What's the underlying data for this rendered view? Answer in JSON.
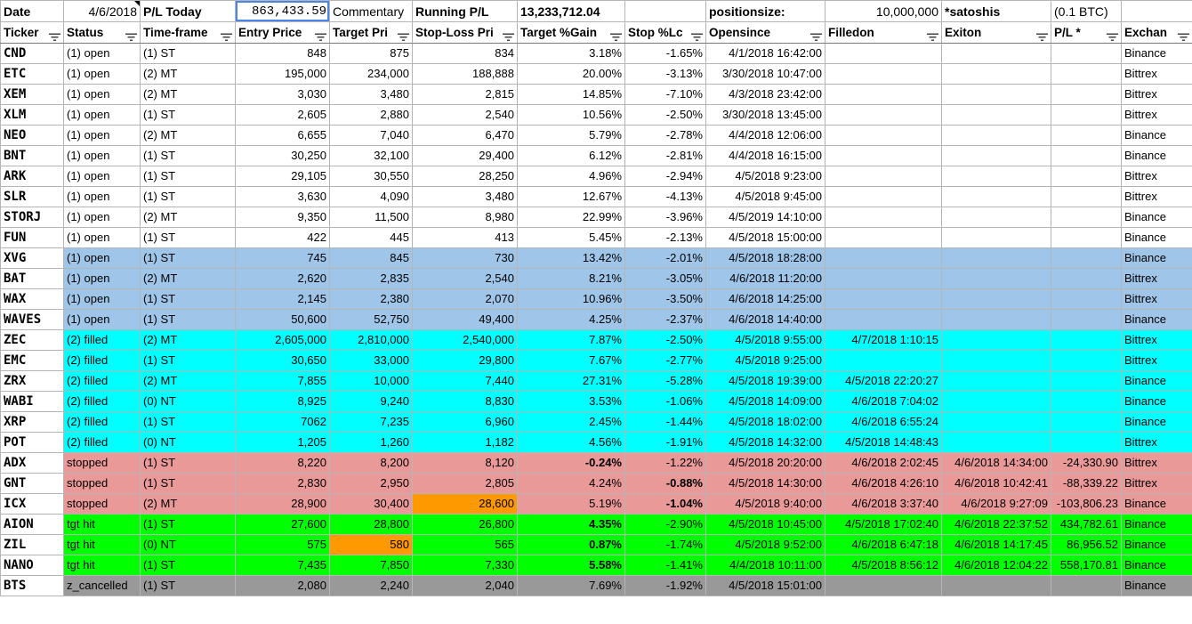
{
  "top": {
    "date_label": "Date",
    "date_value": "4/6/2018",
    "pl_today_label": "P/L Today",
    "pl_today_value": "863,433.59",
    "commentary_label": "Commentary",
    "running_label": "Running P/L",
    "running_value": "13,233,712.04",
    "positionsize_label": "positionsize:",
    "positionsize_value": "10,000,000",
    "unit_label": "*satoshis",
    "btc_note": "(0.1 BTC)"
  },
  "headers": [
    "Ticker",
    "Status",
    "Time-frame",
    "Entry Price",
    "Target Pri",
    "Stop-Loss Pri",
    "Target %Gain",
    "Stop %Lc",
    "Opensince",
    "Filledon",
    "Exiton",
    "P/L *",
    "Exchan"
  ],
  "colors": {
    "open_highlight": "#9fc5e8",
    "filled": "#00ffff",
    "stopped": "#ea9999",
    "tgt_hit": "#00ff00",
    "cancelled": "#999999",
    "orange_cell": "#ff9900"
  },
  "rows": [
    {
      "ticker": "CND",
      "status": "(1) open",
      "tf": "(1) ST",
      "entry": "848",
      "target": "875",
      "stop": "834",
      "tgain": "3.18%",
      "sloss": "-1.65%",
      "open": "4/1/2018 16:42:00",
      "filled": "",
      "exit": "",
      "pl": "",
      "exch": "Binance"
    },
    {
      "ticker": "ETC",
      "status": "(1) open",
      "tf": "(2) MT",
      "entry": "195,000",
      "target": "234,000",
      "stop": "188,888",
      "tgain": "20.00%",
      "sloss": "-3.13%",
      "open": "3/30/2018 10:47:00",
      "filled": "",
      "exit": "",
      "pl": "",
      "exch": "Bittrex"
    },
    {
      "ticker": "XEM",
      "status": "(1) open",
      "tf": "(2) MT",
      "entry": "3,030",
      "target": "3,480",
      "stop": "2,815",
      "tgain": "14.85%",
      "sloss": "-7.10%",
      "open": "4/3/2018 23:42:00",
      "filled": "",
      "exit": "",
      "pl": "",
      "exch": "Bittrex"
    },
    {
      "ticker": "XLM",
      "status": "(1) open",
      "tf": "(1) ST",
      "entry": "2,605",
      "target": "2,880",
      "stop": "2,540",
      "tgain": "10.56%",
      "sloss": "-2.50%",
      "open": "3/30/2018 13:45:00",
      "filled": "",
      "exit": "",
      "pl": "",
      "exch": "Bittrex"
    },
    {
      "ticker": "NEO",
      "status": "(1) open",
      "tf": "(2) MT",
      "entry": "6,655",
      "target": "7,040",
      "stop": "6,470",
      "tgain": "5.79%",
      "sloss": "-2.78%",
      "open": "4/4/2018 12:06:00",
      "filled": "",
      "exit": "",
      "pl": "",
      "exch": "Binance"
    },
    {
      "ticker": "BNT",
      "status": "(1) open",
      "tf": "(1) ST",
      "entry": "30,250",
      "target": "32,100",
      "stop": "29,400",
      "tgain": "6.12%",
      "sloss": "-2.81%",
      "open": "4/4/2018 16:15:00",
      "filled": "",
      "exit": "",
      "pl": "",
      "exch": "Binance"
    },
    {
      "ticker": "ARK",
      "status": "(1) open",
      "tf": "(1) ST",
      "entry": "29,105",
      "target": "30,550",
      "stop": "28,250",
      "tgain": "4.96%",
      "sloss": "-2.94%",
      "open": "4/5/2018 9:23:00",
      "filled": "",
      "exit": "",
      "pl": "",
      "exch": "Bittrex"
    },
    {
      "ticker": "SLR",
      "status": "(1) open",
      "tf": "(1) ST",
      "entry": "3,630",
      "target": "4,090",
      "stop": "3,480",
      "tgain": "12.67%",
      "sloss": "-4.13%",
      "open": "4/5/2018 9:45:00",
      "filled": "",
      "exit": "",
      "pl": "",
      "exch": "Bittrex"
    },
    {
      "ticker": "STORJ",
      "status": "(1) open",
      "tf": "(2) MT",
      "entry": "9,350",
      "target": "11,500",
      "stop": "8,980",
      "tgain": "22.99%",
      "sloss": "-3.96%",
      "open": "4/5/2019 14:10:00",
      "filled": "",
      "exit": "",
      "pl": "",
      "exch": "Binance"
    },
    {
      "ticker": "FUN",
      "status": "(1) open",
      "tf": "(1) ST",
      "entry": "422",
      "target": "445",
      "stop": "413",
      "tgain": "5.45%",
      "sloss": "-2.13%",
      "open": "4/5/2018 15:00:00",
      "filled": "",
      "exit": "",
      "pl": "",
      "exch": "Binance"
    },
    {
      "ticker": "XVG",
      "status": "(1) open",
      "tf": "(1) ST",
      "entry": "745",
      "target": "845",
      "stop": "730",
      "tgain": "13.42%",
      "sloss": "-2.01%",
      "open": "4/5/2018 18:28:00",
      "filled": "",
      "exit": "",
      "pl": "",
      "exch": "Binance",
      "cls": "bg-open2"
    },
    {
      "ticker": "BAT",
      "status": "(1) open",
      "tf": "(2) MT",
      "entry": "2,620",
      "target": "2,835",
      "stop": "2,540",
      "tgain": "8.21%",
      "sloss": "-3.05%",
      "open": "4/6/2018 11:20:00",
      "filled": "",
      "exit": "",
      "pl": "",
      "exch": "Bittrex",
      "cls": "bg-open2"
    },
    {
      "ticker": "WAX",
      "status": "(1) open",
      "tf": "(1) ST",
      "entry": "2,145",
      "target": "2,380",
      "stop": "2,070",
      "tgain": "10.96%",
      "sloss": "-3.50%",
      "open": "4/6/2018 14:25:00",
      "filled": "",
      "exit": "",
      "pl": "",
      "exch": "Bittrex",
      "cls": "bg-open2"
    },
    {
      "ticker": "WAVES",
      "status": "(1) open",
      "tf": "(1) ST",
      "entry": "50,600",
      "target": "52,750",
      "stop": "49,400",
      "tgain": "4.25%",
      "sloss": "-2.37%",
      "open": "4/6/2018 14:40:00",
      "filled": "",
      "exit": "",
      "pl": "",
      "exch": "Binance",
      "cls": "bg-open2"
    },
    {
      "ticker": "ZEC",
      "status": "(2) filled",
      "tf": "(2) MT",
      "entry": "2,605,000",
      "target": "2,810,000",
      "stop": "2,540,000",
      "tgain": "7.87%",
      "sloss": "-2.50%",
      "open": "4/5/2018 9:55:00",
      "filled": "4/7/2018 1:10:15",
      "exit": "",
      "pl": "",
      "exch": "Bittrex",
      "cls": "bg-filled"
    },
    {
      "ticker": "EMC",
      "status": "(2) filled",
      "tf": "(1) ST",
      "entry": "30,650",
      "target": "33,000",
      "stop": "29,800",
      "tgain": "7.67%",
      "sloss": "-2.77%",
      "open": "4/5/2018 9:25:00",
      "filled": "",
      "exit": "",
      "pl": "",
      "exch": "Bittrex",
      "cls": "bg-filled"
    },
    {
      "ticker": "ZRX",
      "status": "(2) filled",
      "tf": "(2) MT",
      "entry": "7,855",
      "target": "10,000",
      "stop": "7,440",
      "tgain": "27.31%",
      "sloss": "-5.28%",
      "open": "4/5/2018 19:39:00",
      "filled": "4/5/2018 22:20:27",
      "exit": "",
      "pl": "",
      "exch": "Binance",
      "cls": "bg-filled"
    },
    {
      "ticker": "WABI",
      "status": "(2) filled",
      "tf": "(0) NT",
      "entry": "8,925",
      "target": "9,240",
      "stop": "8,830",
      "tgain": "3.53%",
      "sloss": "-1.06%",
      "open": "4/5/2018 14:09:00",
      "filled": "4/6/2018 7:04:02",
      "exit": "",
      "pl": "",
      "exch": "Binance",
      "cls": "bg-filled"
    },
    {
      "ticker": "XRP",
      "status": "(2) filled",
      "tf": "(1) ST",
      "entry": "7062",
      "target": "7,235",
      "stop": "6,960",
      "tgain": "2.45%",
      "sloss": "-1.44%",
      "open": "4/5/2018 18:02:00",
      "filled": "4/6/2018 6:55:24",
      "exit": "",
      "pl": "",
      "exch": "Binance",
      "cls": "bg-filled"
    },
    {
      "ticker": "POT",
      "status": "(2) filled",
      "tf": "(0) NT",
      "entry": "1,205",
      "target": "1,260",
      "stop": "1,182",
      "tgain": "4.56%",
      "sloss": "-1.91%",
      "open": "4/5/2018 14:32:00",
      "filled": "4/5/2018 14:48:43",
      "exit": "",
      "pl": "",
      "exch": "Bittrex",
      "cls": "bg-filled"
    },
    {
      "ticker": "ADX",
      "status": "stopped",
      "tf": "(1) ST",
      "entry": "8,220",
      "target": "8,200",
      "stop": "8,120",
      "tgain": "-0.24%",
      "sloss": "-1.22%",
      "open": "4/5/2018 20:20:00",
      "filled": "4/6/2018 2:02:45",
      "exit": "4/6/2018 14:34:00",
      "pl": "-24,330.90",
      "exch": "Bittrex",
      "cls": "bg-stop",
      "tgain_bold": true
    },
    {
      "ticker": "GNT",
      "status": "stopped",
      "tf": "(1) ST",
      "entry": "2,830",
      "target": "2,950",
      "stop": "2,805",
      "tgain": "4.24%",
      "sloss": "-0.88%",
      "open": "4/5/2018 14:30:00",
      "filled": "4/6/2018 4:26:10",
      "exit": "4/6/2018 10:42:41",
      "pl": "-88,339.22",
      "exch": "Bittrex",
      "cls": "bg-stop",
      "sloss_bold": true
    },
    {
      "ticker": "ICX",
      "status": "stopped",
      "tf": "(2) MT",
      "entry": "28,900",
      "target": "30,400",
      "stop": "28,600",
      "tgain": "5.19%",
      "sloss": "-1.04%",
      "open": "4/5/2018 9:40:00",
      "filled": "4/6/2018 3:37:40",
      "exit": "4/6/2018 9:27:09",
      "pl": "-103,806.23",
      "exch": "Binance",
      "cls": "bg-stop",
      "sloss_bold": true,
      "stop_orange": true
    },
    {
      "ticker": "AION",
      "status": "tgt hit",
      "tf": "(1) ST",
      "entry": "27,600",
      "target": "28,800",
      "stop": "26,800",
      "tgain": "4.35%",
      "sloss": "-2.90%",
      "open": "4/5/2018 10:45:00",
      "filled": "4/5/2018 17:02:40",
      "exit": "4/6/2018 22:37:52",
      "pl": "434,782.61",
      "exch": "Binance",
      "cls": "bg-tgt",
      "tgain_bold": true
    },
    {
      "ticker": "ZIL",
      "status": "tgt hit",
      "tf": "(0) NT",
      "entry": "575",
      "target": "580",
      "stop": "565",
      "tgain": "0.87%",
      "sloss": "-1.74%",
      "open": "4/5/2018 9:52:00",
      "filled": "4/6/2018 6:47:18",
      "exit": "4/6/2018 14:17:45",
      "pl": "86,956.52",
      "exch": "Binance",
      "cls": "bg-tgt",
      "tgain_bold": true,
      "target_orange": true
    },
    {
      "ticker": "NANO",
      "status": "tgt hit",
      "tf": "(1) ST",
      "entry": "7,435",
      "target": "7,850",
      "stop": "7,330",
      "tgain": "5.58%",
      "sloss": "-1.41%",
      "open": "4/4/2018 10:11:00",
      "filled": "4/5/2018 8:56:12",
      "exit": "4/6/2018 12:04:22",
      "pl": "558,170.81",
      "exch": "Binance",
      "cls": "bg-tgt",
      "tgain_bold": true
    },
    {
      "ticker": "BTS",
      "status": "z_cancelled",
      "tf": "(1) ST",
      "entry": "2,080",
      "target": "2,240",
      "stop": "2,040",
      "tgain": "7.69%",
      "sloss": "-1.92%",
      "open": "4/5/2018 15:01:00",
      "filled": "",
      "exit": "",
      "pl": "",
      "exch": "Binance",
      "cls": "bg-cancel"
    }
  ]
}
